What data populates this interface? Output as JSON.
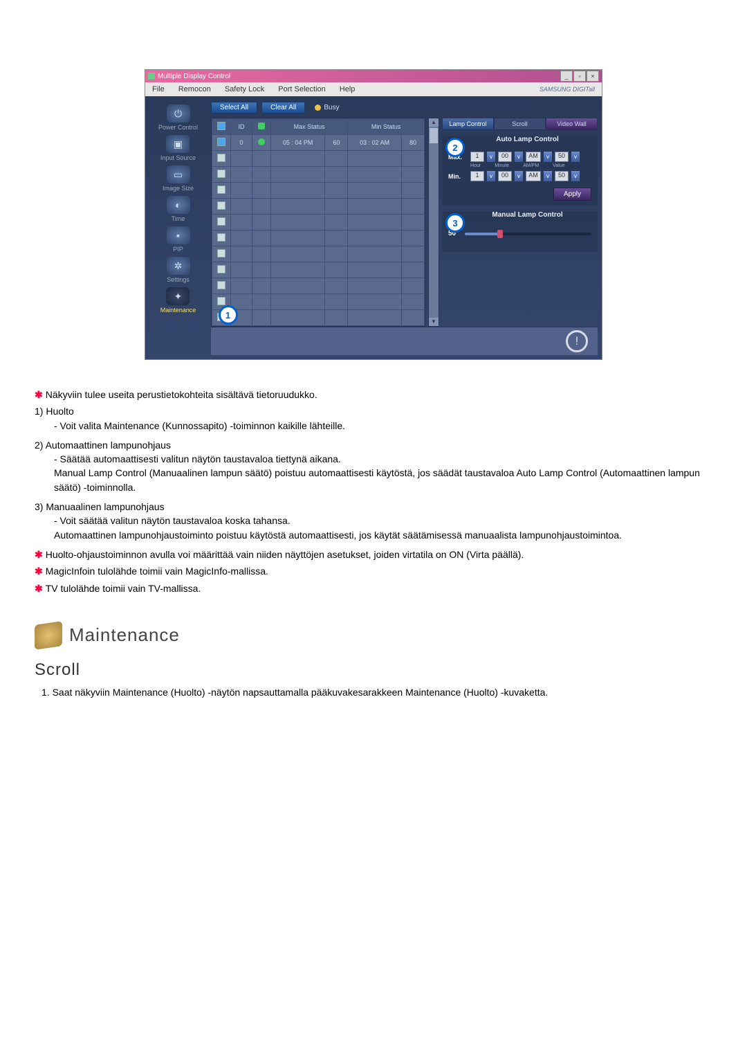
{
  "win": {
    "title": "Multiple Display Control"
  },
  "menu": {
    "file": "File",
    "remocon": "Remocon",
    "safety": "Safety Lock",
    "port": "Port Selection",
    "help": "Help",
    "brand": "SAMSUNG DIGITall"
  },
  "sidebar": [
    {
      "label": "Power Control"
    },
    {
      "label": "Input Source"
    },
    {
      "label": "Image Size"
    },
    {
      "label": "Time"
    },
    {
      "label": "PIP"
    },
    {
      "label": "Settings"
    },
    {
      "label": "Maintenance"
    }
  ],
  "callouts": {
    "c1": "1",
    "c2": "2",
    "c3": "3"
  },
  "buttons": {
    "selectAll": "Select All",
    "clearAll": "Clear All",
    "busy": "Busy"
  },
  "grid": {
    "headers": {
      "id": "ID",
      "max": "Max Status",
      "min": "Min Status"
    },
    "row": {
      "id": "0",
      "maxTime": "05 : 04 PM",
      "maxVal": "60",
      "minTime": "03 : 02 AM",
      "minVal": "80"
    }
  },
  "rpanel": {
    "tabs": {
      "lamp": "Lamp Control",
      "scroll": "Scroll",
      "video": "Video Wall"
    },
    "auto": {
      "title": "Auto Lamp Control",
      "max": "Max.",
      "min": "Min.",
      "h1": "1",
      "m1": "00",
      "ap1": "AM",
      "v1": "50",
      "h2": "1",
      "m2": "00",
      "ap2": "AM",
      "v2": "50",
      "hour": "Hour",
      "minute": "Minute",
      "ampm": "AM/PM",
      "value": "Value",
      "apply": "Apply"
    },
    "manual": {
      "title": "Manual Lamp Control",
      "val": "50"
    }
  },
  "body": {
    "s1": "Näkyviin tulee useita perustietokohteita sisältävä tietoruudukko.",
    "i1h": "1)  Huolto",
    "i1a": "- Voit valita Maintenance (Kunnossapito) -toiminnon kaikille lähteille.",
    "i2h": "2)  Automaattinen lampunohjaus",
    "i2a": "- Säätää automaattisesti valitun näytön taustavaloa tiettynä aikana.",
    "i2b": "Manual Lamp Control (Manuaalinen lampun säätö) poistuu automaattisesti käytöstä, jos säädät taustavaloa Auto Lamp Control (Automaattinen lampun säätö) -toiminnolla.",
    "i3h": "3)  Manuaalinen lampunohjaus",
    "i3a": "- Voit säätää valitun näytön taustavaloa koska tahansa.",
    "i3b": "Automaattinen lampunohjaustoiminto poistuu käytöstä automaattisesti, jos käytät säätämisessä manuaalista lampunohjaustoimintoa.",
    "s2": "Huolto-ohjaustoiminnon avulla voi määrittää vain niiden näyttöjen asetukset, joiden virtatila on ON (Virta päällä).",
    "s3": "MagicInfoin tulolähde toimii vain MagicInfo-mallissa.",
    "s4": "TV tulolähde toimii vain TV-mallissa.",
    "maint": "Maintenance",
    "scrollH": "Scroll",
    "scrollP": "1. Saat näkyviin Maintenance (Huolto) -näytön napsauttamalla pääkuvakesarakkeen Maintenance (Huolto) -kuvaketta."
  }
}
